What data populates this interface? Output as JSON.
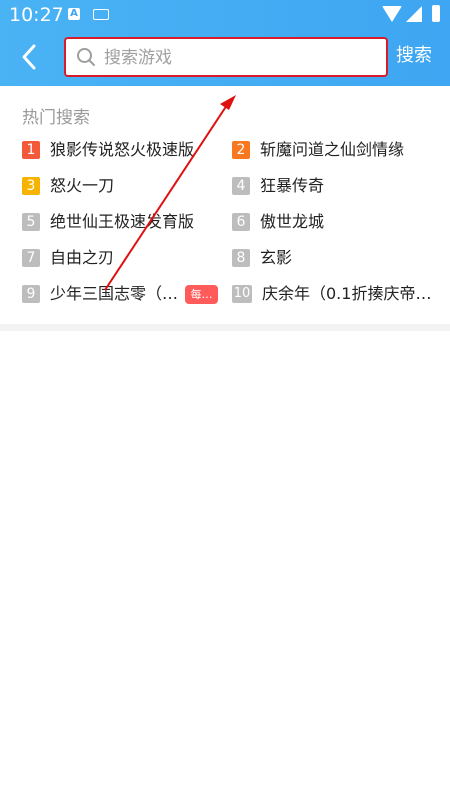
{
  "status_bar": {
    "time": "10:27"
  },
  "header": {
    "search_placeholder": "搜索游戏",
    "search_button_label": "搜索"
  },
  "hot_search": {
    "title": "热门搜索",
    "items": [
      {
        "rank": "1",
        "label": "狼影传说怒火极速版",
        "rank_color": "#f45a3a"
      },
      {
        "rank": "2",
        "label": "斩魔问道之仙剑情缘",
        "rank_color": "#f7781e"
      },
      {
        "rank": "3",
        "label": "怒火一刀",
        "rank_color": "#f6b400"
      },
      {
        "rank": "4",
        "label": "狂暴传奇",
        "rank_color": "#bdbdbd"
      },
      {
        "rank": "5",
        "label": "绝世仙王极速发育版",
        "rank_color": "#bdbdbd"
      },
      {
        "rank": "6",
        "label": "傲世龙城",
        "rank_color": "#bdbdbd"
      },
      {
        "rank": "7",
        "label": "自由之刃",
        "rank_color": "#bdbdbd"
      },
      {
        "rank": "8",
        "label": "玄影",
        "rank_color": "#bdbdbd"
      },
      {
        "rank": "9",
        "label": "少年三国志零（…",
        "rank_color": "#bdbdbd",
        "badge": "每…"
      },
      {
        "rank": "10",
        "label": "庆余年（0.1折揍庆帝…",
        "rank_color": "#bdbdbd"
      }
    ]
  },
  "colors": {
    "header_blue": "#3ea6f2",
    "highlight_red": "#d81b2a"
  }
}
